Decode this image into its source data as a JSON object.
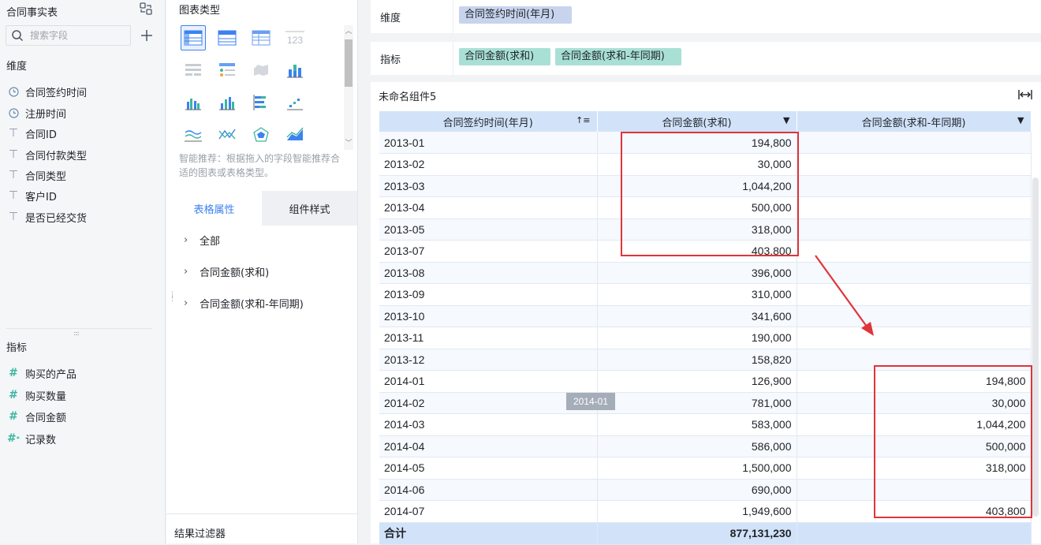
{
  "left": {
    "title": "合同事实表",
    "search_placeholder": "搜索字段",
    "dim_label": "维度",
    "dimensions": [
      {
        "label": "合同签约时间",
        "icon": "clock-icon"
      },
      {
        "label": "注册时间",
        "icon": "clock-icon"
      },
      {
        "label": "合同ID",
        "icon": "text-type-icon"
      },
      {
        "label": "合同付款类型",
        "icon": "text-type-icon"
      },
      {
        "label": "合同类型",
        "icon": "text-type-icon"
      },
      {
        "label": "客户ID",
        "icon": "text-type-icon"
      },
      {
        "label": "是否已经交货",
        "icon": "text-type-icon"
      }
    ],
    "mea_label": "指标",
    "measures": [
      {
        "label": "购买的产品",
        "icon": "hash-icon"
      },
      {
        "label": "购买数量",
        "icon": "hash-icon"
      },
      {
        "label": "合同金额",
        "icon": "hash-icon"
      },
      {
        "label": "记录数",
        "icon": "hash-star-icon"
      }
    ]
  },
  "mid": {
    "title": "图表类型",
    "hint": "智能推荐：根据拖入的字段智能推荐合适的图表或表格类型。",
    "tabs": [
      "表格属性",
      "组件样式"
    ],
    "props": [
      "全部",
      "合同金额(求和)",
      "合同金额(求和-年同期)"
    ],
    "footer": "结果过滤器",
    "table_icon_label": "123"
  },
  "config": {
    "dim_label": "维度",
    "dim_pill": "合同签约时间(年月)",
    "mea_label": "指标",
    "mea_pills": [
      "合同金额(求和)",
      "合同金额(求和-年同期)"
    ]
  },
  "widget": {
    "title": "未命名组件5",
    "headers": [
      "合同签约时间(年月)",
      "合同金额(求和)",
      "合同金额(求和-年同期)"
    ],
    "rows": [
      [
        "2013-01",
        "194,800",
        ""
      ],
      [
        "2013-02",
        "30,000",
        ""
      ],
      [
        "2013-03",
        "1,044,200",
        ""
      ],
      [
        "2013-04",
        "500,000",
        ""
      ],
      [
        "2013-05",
        "318,000",
        ""
      ],
      [
        "2013-07",
        "403,800",
        ""
      ],
      [
        "2013-08",
        "396,000",
        ""
      ],
      [
        "2013-09",
        "310,000",
        ""
      ],
      [
        "2013-10",
        "341,600",
        ""
      ],
      [
        "2013-11",
        "190,000",
        ""
      ],
      [
        "2013-12",
        "158,820",
        ""
      ],
      [
        "2014-01",
        "126,900",
        "194,800"
      ],
      [
        "2014-02",
        "781,000",
        "30,000"
      ],
      [
        "2014-03",
        "583,000",
        "1,044,200"
      ],
      [
        "2014-04",
        "586,000",
        "500,000"
      ],
      [
        "2014-05",
        "1,500,000",
        "318,000"
      ],
      [
        "2014-06",
        "690,000",
        ""
      ],
      [
        "2014-07",
        "1,949,600",
        "403,800"
      ]
    ],
    "total_label": "合计",
    "total_value": "877,131,230",
    "tooltip": "2014-01"
  },
  "colors": {
    "accent": "#3c82f0",
    "header_bg": "#d2e3f9",
    "dim_pill": "#c8d4ee",
    "mea_pill": "#a9e0d6",
    "annotation": "#e0343a"
  }
}
